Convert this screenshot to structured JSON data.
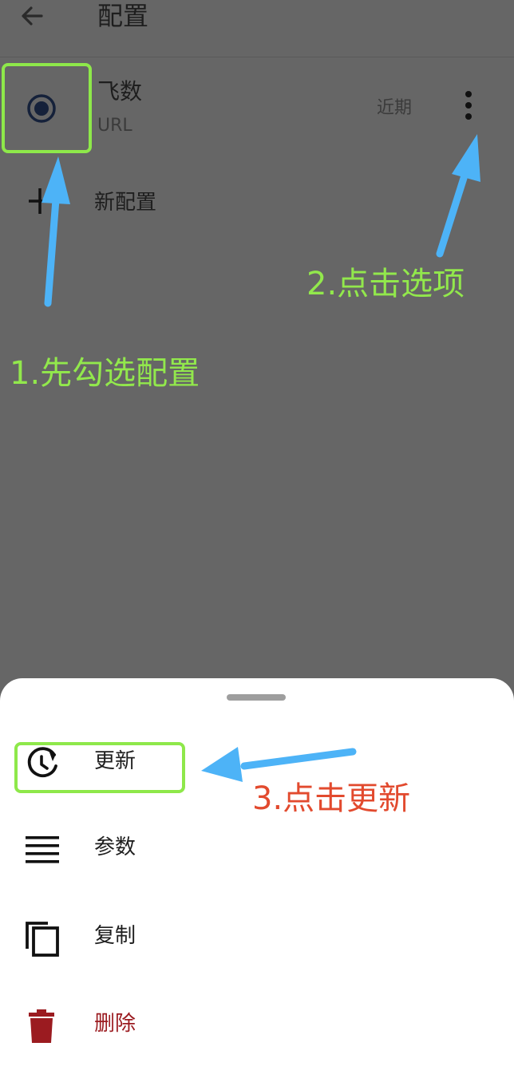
{
  "appbar": {
    "title": "配置",
    "back_icon": "arrow-left-icon"
  },
  "profile": {
    "name": "飞数",
    "type": "URL",
    "updated": "近期",
    "selected": true,
    "more_icon": "more-vertical-icon"
  },
  "new_profile": {
    "label": "新配置",
    "icon": "plus-icon"
  },
  "sheet": {
    "items": [
      {
        "label": "更新",
        "icon": "update-clock-icon"
      },
      {
        "label": "参数",
        "icon": "menu-lines-icon"
      },
      {
        "label": "复制",
        "icon": "copy-icon"
      },
      {
        "label": "删除",
        "icon": "trash-icon"
      }
    ]
  },
  "annotations": {
    "step1": "1.先勾选配置",
    "step2": "2.点击选项",
    "step3": "3.点击更新"
  },
  "colors": {
    "scrim": "#666666",
    "annotation_green": "#92e84c",
    "annotation_red": "#e24a2e",
    "arrow_blue": "#4db3f7",
    "danger": "#9b1b20"
  }
}
